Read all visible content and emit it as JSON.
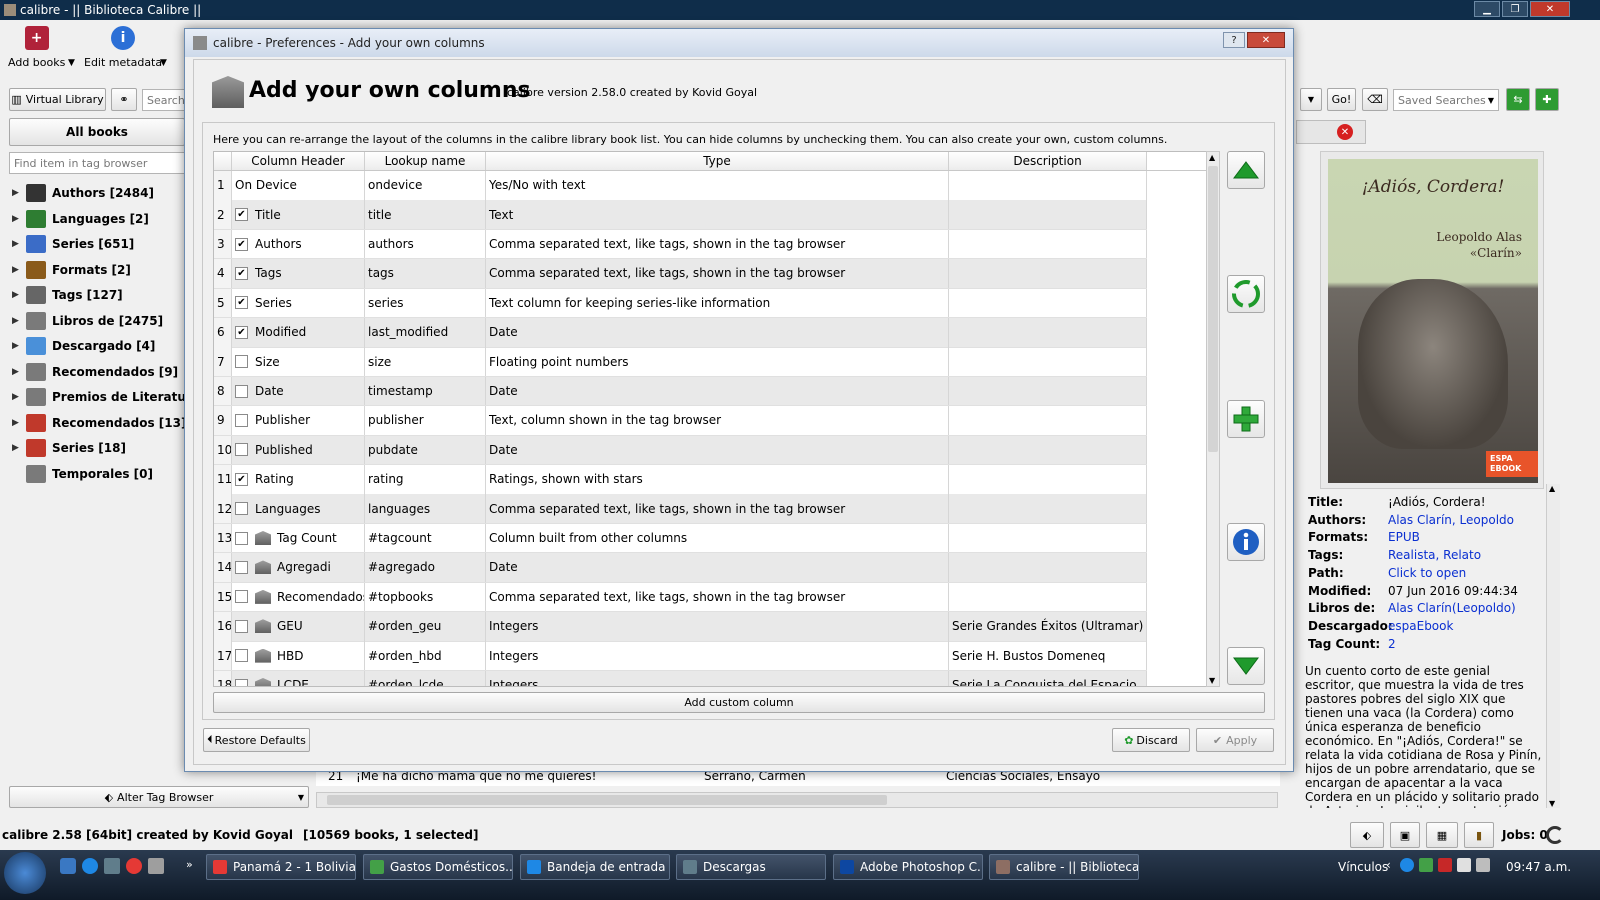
{
  "window": {
    "title": "calibre - || Biblioteca Calibre ||"
  },
  "toolbar": {
    "add_books": "Add books",
    "edit_metadata": "Edit metadata"
  },
  "left": {
    "virtual_library": "Virtual Library",
    "search_placeholder": "Search",
    "all_books": "All books",
    "find_placeholder": "Find item in tag browser",
    "alter_tag_browser": "Alter Tag Browser",
    "tree": [
      {
        "label": "Authors [2484]",
        "icon": "person-icon"
      },
      {
        "label": "Languages [2]",
        "icon": "languages-icon"
      },
      {
        "label": "Series [651]",
        "icon": "series-icon"
      },
      {
        "label": "Formats [2]",
        "icon": "formats-icon"
      },
      {
        "label": "Tags [127]",
        "icon": "tag-icon"
      },
      {
        "label": "Libros de [2475]",
        "icon": "column-icon"
      },
      {
        "label": "Descargado [4]",
        "icon": "download-icon"
      },
      {
        "label": "Recomendados [9]",
        "icon": "column-icon"
      },
      {
        "label": "Premios de Literatura [",
        "icon": "column-icon"
      },
      {
        "label": "Recomendados [13]",
        "icon": "books-icon"
      },
      {
        "label": "Series [18]",
        "icon": "books-icon"
      },
      {
        "label": "Temporales [0]",
        "icon": "column-icon"
      }
    ]
  },
  "search_bar": {
    "go": "Go!",
    "saved_searches": "Saved Searches"
  },
  "dialog": {
    "title": "calibre - Preferences - Add your own columns",
    "heading": "Add your own columns",
    "version": "calibre version 2.58.0 created by Kovid Goyal",
    "description": "Here you can re-arrange the layout of the columns in the calibre library book list. You can hide columns by unchecking them. You can also create your own, custom columns.",
    "headers": [
      "Column Header",
      "Lookup name",
      "Type",
      "Description"
    ],
    "rows": [
      {
        "n": "1",
        "header": "On Device",
        "lookup": "ondevice",
        "type": "Yes/No with text",
        "desc": "",
        "checked": null,
        "custom": false
      },
      {
        "n": "2",
        "header": "Title",
        "lookup": "title",
        "type": "Text",
        "desc": "",
        "checked": true,
        "custom": false
      },
      {
        "n": "3",
        "header": "Authors",
        "lookup": "authors",
        "type": "Comma separated text, like tags, shown in the tag browser",
        "desc": "",
        "checked": true,
        "custom": false
      },
      {
        "n": "4",
        "header": "Tags",
        "lookup": "tags",
        "type": "Comma separated text, like tags, shown in the tag browser",
        "desc": "",
        "checked": true,
        "custom": false
      },
      {
        "n": "5",
        "header": "Series",
        "lookup": "series",
        "type": "Text column for keeping series-like information",
        "desc": "",
        "checked": true,
        "custom": false
      },
      {
        "n": "6",
        "header": "Modified",
        "lookup": "last_modified",
        "type": "Date",
        "desc": "",
        "checked": true,
        "custom": false
      },
      {
        "n": "7",
        "header": "Size",
        "lookup": "size",
        "type": "Floating point numbers",
        "desc": "",
        "checked": false,
        "custom": false
      },
      {
        "n": "8",
        "header": "Date",
        "lookup": "timestamp",
        "type": "Date",
        "desc": "",
        "checked": false,
        "custom": false
      },
      {
        "n": "9",
        "header": "Publisher",
        "lookup": "publisher",
        "type": "Text, column shown in the tag browser",
        "desc": "",
        "checked": false,
        "custom": false
      },
      {
        "n": "10",
        "header": "Published",
        "lookup": "pubdate",
        "type": "Date",
        "desc": "",
        "checked": false,
        "custom": false
      },
      {
        "n": "11",
        "header": "Rating",
        "lookup": "rating",
        "type": "Ratings, shown with stars",
        "desc": "",
        "checked": true,
        "custom": false
      },
      {
        "n": "12",
        "header": "Languages",
        "lookup": "languages",
        "type": "Comma separated text, like tags, shown in the tag browser",
        "desc": "",
        "checked": false,
        "custom": false
      },
      {
        "n": "13",
        "header": "Tag Count",
        "lookup": "#tagcount",
        "type": "Column built from other columns",
        "desc": "",
        "checked": false,
        "custom": true
      },
      {
        "n": "14",
        "header": "Agregadi",
        "lookup": "#agregado",
        "type": "Date",
        "desc": "",
        "checked": false,
        "custom": true
      },
      {
        "n": "15",
        "header": "Recomendados",
        "lookup": "#topbooks",
        "type": "Comma separated text, like tags, shown in the tag browser",
        "desc": "",
        "checked": false,
        "custom": true
      },
      {
        "n": "16",
        "header": "GEU",
        "lookup": "#orden_geu",
        "type": "Integers",
        "desc": "Serie Grandes Éxitos (Ultramar)",
        "checked": false,
        "custom": true
      },
      {
        "n": "17",
        "header": "HBD",
        "lookup": "#orden_hbd",
        "type": "Integers",
        "desc": "Serie H. Bustos Domeneq",
        "checked": false,
        "custom": true
      },
      {
        "n": "18",
        "header": "LCDE",
        "lookup": "#orden_lcde",
        "type": "Integers",
        "desc": "Serie La Conquista del Espacio",
        "checked": false,
        "custom": true
      }
    ],
    "add_custom": "Add custom column",
    "restore_defaults": "Restore Defaults",
    "discard": "Discard",
    "apply": "Apply"
  },
  "book_list": {
    "row_num": "21",
    "title": "¡Me ha dicho mamá que no me quieres!",
    "author": "Serrano, Carmen",
    "tags": "Ciencias Sociales, Ensayo"
  },
  "cover": {
    "title": "¡Adiós, Cordera!",
    "author_line1": "Leopoldo Alas",
    "author_line2": "«Clarín»",
    "badge_top": "ESPA",
    "badge_bottom": "EBOOK"
  },
  "details": {
    "rows": [
      {
        "k": "Title:",
        "v": "¡Adiós, Cordera!",
        "link": false
      },
      {
        "k": "Authors:",
        "v": "Alas Clarín, Leopoldo",
        "link": true
      },
      {
        "k": "Formats:",
        "v": "EPUB",
        "link": true
      },
      {
        "k": "Tags:",
        "v": "Realista, Relato",
        "link": true
      },
      {
        "k": "Path:",
        "v": "Click to open",
        "link": true
      },
      {
        "k": "Modified:",
        "v": "07 Jun 2016 09:44:34",
        "link": false
      },
      {
        "k": "Libros de:",
        "v": "Alas Clarín(Leopoldo)",
        "link": true
      },
      {
        "k": "Descargado:",
        "v": "espaEbook",
        "link": true
      },
      {
        "k": "Tag Count:",
        "v": "2",
        "link": true
      }
    ],
    "summary": "Un cuento corto de este genial escritor, que muestra la vida de tres pastores pobres del siglo XIX que tienen una vaca (la Cordera) como única esperanza de beneficio económico. En \"¡Adiós, Cordera!\" se relata la vida cotidiana de Rosa y Pinín, hijos de un pobre arrendatario, que se encargan de apacentar a la vaca Cordera en un plácido y solitario prado de Asturias. La vigilante protección que les prodiga el padre, Antón de Chinta; el amor que une a"
  },
  "status": {
    "left": "calibre 2.58 [64bit] created by Kovid Goyal",
    "count": "[10569 books, 1 selected]",
    "jobs": "Jobs: 0"
  },
  "taskbar": {
    "tasks": [
      "Panamá 2 - 1 Bolivia...",
      "Gastos Domésticos....",
      "Bandeja de entrada ...",
      "Descargas",
      "Adobe Photoshop C...",
      "calibre - || Biblioteca..."
    ],
    "vinculos": "Vínculos",
    "clock": "09:47 a.m."
  }
}
